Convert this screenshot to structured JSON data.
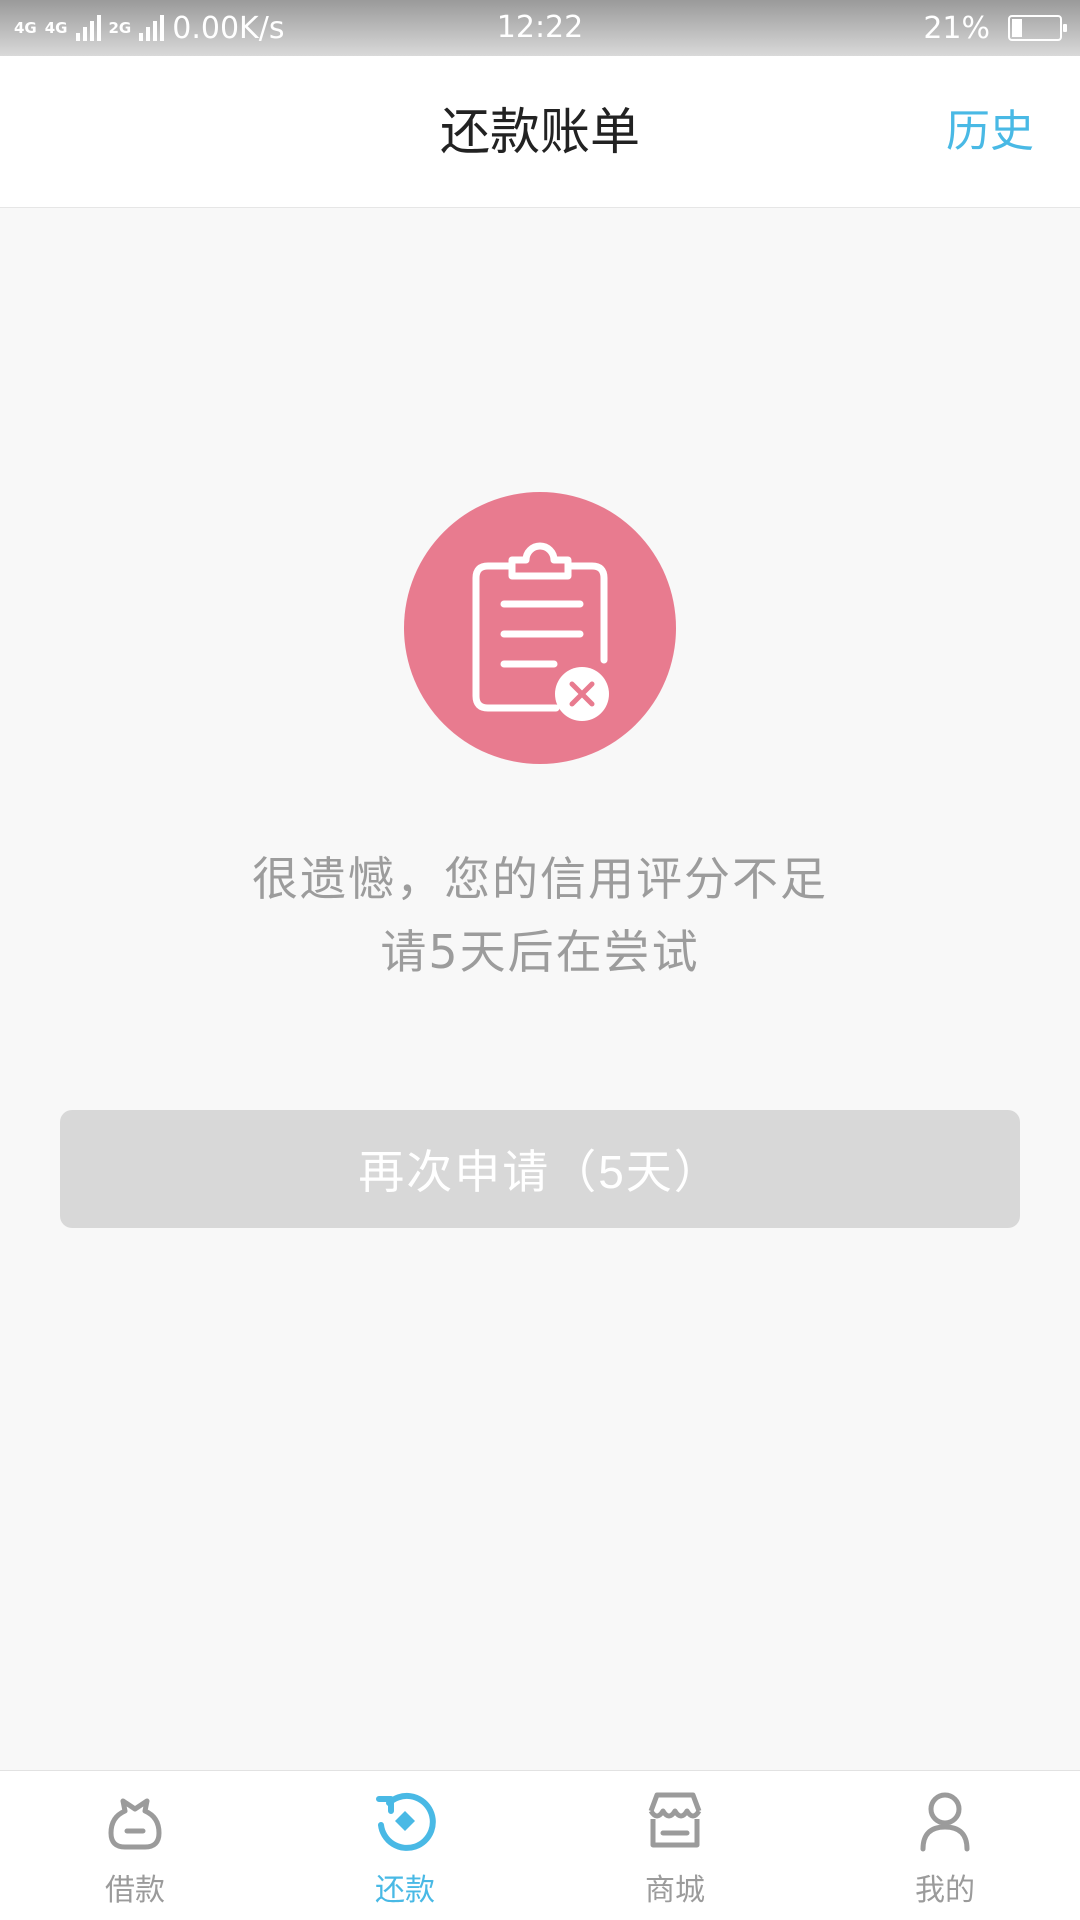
{
  "status_bar": {
    "net1": "4G",
    "net2": "4G",
    "net3": "2G",
    "speed": "0.00K/s",
    "time": "12:22",
    "battery": "21%",
    "battery_level": 0.21
  },
  "header": {
    "title": "还款账单",
    "history_label": "历史"
  },
  "main": {
    "icon": "clipboard-rejected-icon",
    "message_line1": "很遗憾，您的信用评分不足",
    "message_line2": "请5天后在尝试",
    "retry_label": "再次申请（5天）"
  },
  "tabs": [
    {
      "label": "借款",
      "icon": "bag-icon",
      "active": false
    },
    {
      "label": "还款",
      "icon": "refresh-diamond-icon",
      "active": true
    },
    {
      "label": "商城",
      "icon": "store-icon",
      "active": false
    },
    {
      "label": "我的",
      "icon": "user-icon",
      "active": false
    }
  ],
  "colors": {
    "accent": "#49b9e5",
    "illustration": "#e87b8f",
    "button_disabled": "#d8d8d8",
    "inactive": "#9b9b9b"
  }
}
